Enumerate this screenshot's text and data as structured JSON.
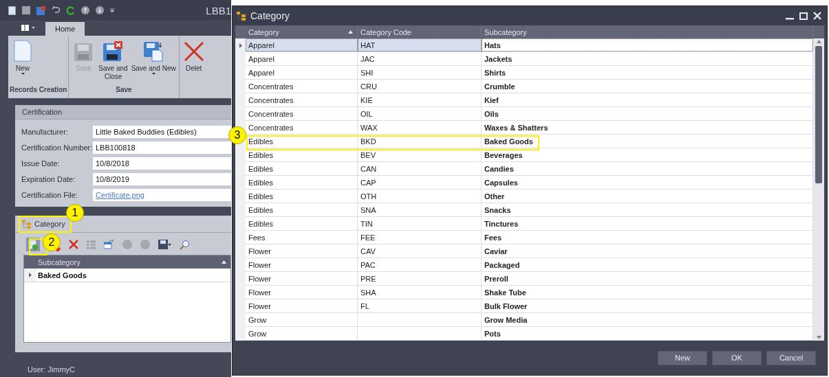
{
  "app_window": {
    "title": "LBB1",
    "tabs": [
      {
        "label": "Home",
        "selected": true
      }
    ],
    "ribbon_groups": [
      {
        "label": "Records Creation",
        "buttons": [
          {
            "label": "New",
            "kind": "new",
            "dropdown": true,
            "disabled": false
          }
        ]
      },
      {
        "label": "Save",
        "buttons": [
          {
            "label": "Save",
            "kind": "save",
            "dropdown": false,
            "disabled": true
          },
          {
            "label": "Save and\nClose",
            "kind": "save-close",
            "dropdown": false,
            "disabled": false
          },
          {
            "label": "Save and New",
            "kind": "save-new",
            "dropdown": true,
            "disabled": false
          }
        ]
      },
      {
        "buttons": [
          {
            "label": "Delet",
            "kind": "delete",
            "dropdown": false,
            "disabled": false
          }
        ]
      }
    ],
    "certification": {
      "title": "Certification",
      "fields": [
        {
          "label": "Manufacturer:",
          "value": "Little Baked Buddies (Edibles)",
          "kind": "text"
        },
        {
          "label": "Certification Number:",
          "value": "LBB100818",
          "kind": "text"
        },
        {
          "label": "Issue Date:",
          "value": "10/8/2018",
          "kind": "text"
        },
        {
          "label": "Expiration Date:",
          "value": "10/8/2019",
          "kind": "text"
        },
        {
          "label": "Certification File:",
          "value": "Certificate.png",
          "kind": "link"
        }
      ]
    },
    "category_panel": {
      "tab": "Category",
      "grid": {
        "columns": [
          {
            "label": "Subcategory",
            "sorted": true
          }
        ],
        "rows": [
          {
            "subcategory": "Baked Goods"
          }
        ]
      }
    },
    "status_bar": "User: JimmyC"
  },
  "dialog": {
    "title": "Category",
    "columns": [
      {
        "label": "Category",
        "sorted": true
      },
      {
        "label": "Category Code",
        "sorted": false
      },
      {
        "label": "Subcategory",
        "sorted": false
      }
    ],
    "rows": [
      {
        "category": "Apparel",
        "code": "HAT",
        "subcategory": "Hats",
        "selected": true
      },
      {
        "category": "Apparel",
        "code": "JAC",
        "subcategory": "Jackets",
        "selected": false
      },
      {
        "category": "Apparel",
        "code": "SHI",
        "subcategory": "Shirts",
        "selected": false
      },
      {
        "category": "Concentrates",
        "code": "CRU",
        "subcategory": "Crumble",
        "selected": false
      },
      {
        "category": "Concentrates",
        "code": "KIE",
        "subcategory": "Kief",
        "selected": false
      },
      {
        "category": "Concentrates",
        "code": "OIL",
        "subcategory": "Oils",
        "selected": false
      },
      {
        "category": "Concentrates",
        "code": "WAX",
        "subcategory": "Waxes & Shatters",
        "selected": false
      },
      {
        "category": "Edibles",
        "code": "BKD",
        "subcategory": "Baked Goods",
        "selected": false
      },
      {
        "category": "Edibles",
        "code": "BEV",
        "subcategory": "Beverages",
        "selected": false
      },
      {
        "category": "Edibles",
        "code": "CAN",
        "subcategory": "Candies",
        "selected": false
      },
      {
        "category": "Edibles",
        "code": "CAP",
        "subcategory": "Capsules",
        "selected": false
      },
      {
        "category": "Edibles",
        "code": "OTH",
        "subcategory": "Other",
        "selected": false
      },
      {
        "category": "Edibles",
        "code": "SNA",
        "subcategory": "Snacks",
        "selected": false
      },
      {
        "category": "Edibles",
        "code": "TIN",
        "subcategory": "Tinctures",
        "selected": false
      },
      {
        "category": "Fees",
        "code": "FEE",
        "subcategory": "Fees",
        "selected": false
      },
      {
        "category": "Flower",
        "code": "CAV",
        "subcategory": "Caviar",
        "selected": false
      },
      {
        "category": "Flower",
        "code": "PAC",
        "subcategory": "Packaged",
        "selected": false
      },
      {
        "category": "Flower",
        "code": "PRE",
        "subcategory": "Preroll",
        "selected": false
      },
      {
        "category": "Flower",
        "code": "SHA",
        "subcategory": "Shake Tube",
        "selected": false
      },
      {
        "category": "Flower",
        "code": "FL",
        "subcategory": "Bulk Flower",
        "selected": false
      },
      {
        "category": "Grow",
        "code": "",
        "subcategory": "Grow Media",
        "selected": false
      },
      {
        "category": "Grow",
        "code": "",
        "subcategory": "Pots",
        "selected": false
      }
    ],
    "buttons": [
      "New",
      "OK",
      "Cancel"
    ]
  },
  "annotations": [
    {
      "number": "1"
    },
    {
      "number": "2"
    },
    {
      "number": "3"
    }
  ]
}
